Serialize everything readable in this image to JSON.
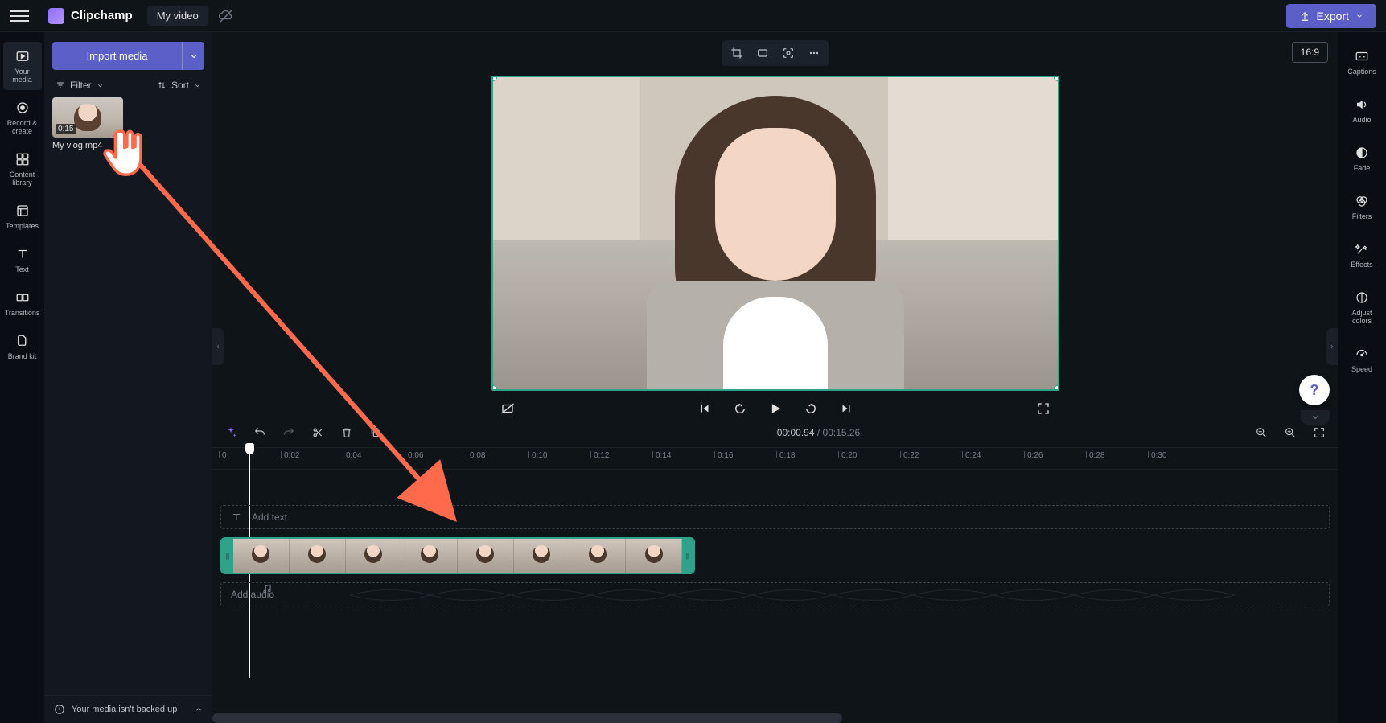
{
  "app": {
    "name": "Clipchamp",
    "project_title": "My video"
  },
  "export": {
    "label": "Export"
  },
  "left_rail": {
    "your_media": "Your media",
    "record_create": "Record & create",
    "content_library": "Content library",
    "templates": "Templates",
    "text": "Text",
    "transitions": "Transitions",
    "brand_kit": "Brand kit"
  },
  "media_panel": {
    "import_label": "Import media",
    "filter_label": "Filter",
    "sort_label": "Sort",
    "clip_duration": "0:15",
    "clip_name": "My vlog.mp4",
    "backup_msg": "Your media isn't backed up"
  },
  "preview": {
    "aspect": "16:9"
  },
  "timeline": {
    "time_current": "00:00.94",
    "time_total": "00:15.26",
    "ruler_ticks": [
      "0",
      "0:02",
      "0:04",
      "0:06",
      "0:08",
      "0:10",
      "0:12",
      "0:14",
      "0:16",
      "0:18",
      "0:20",
      "0:22",
      "0:24",
      "0:26",
      "0:28",
      "0:30"
    ],
    "add_text_label": "Add text",
    "add_audio_label": "Add audio"
  },
  "right_rail": {
    "captions": "Captions",
    "audio": "Audio",
    "fade": "Fade",
    "filters": "Filters",
    "effects": "Effects",
    "adjust_colors": "Adjust colors",
    "speed": "Speed"
  },
  "help": {
    "label": "?"
  }
}
